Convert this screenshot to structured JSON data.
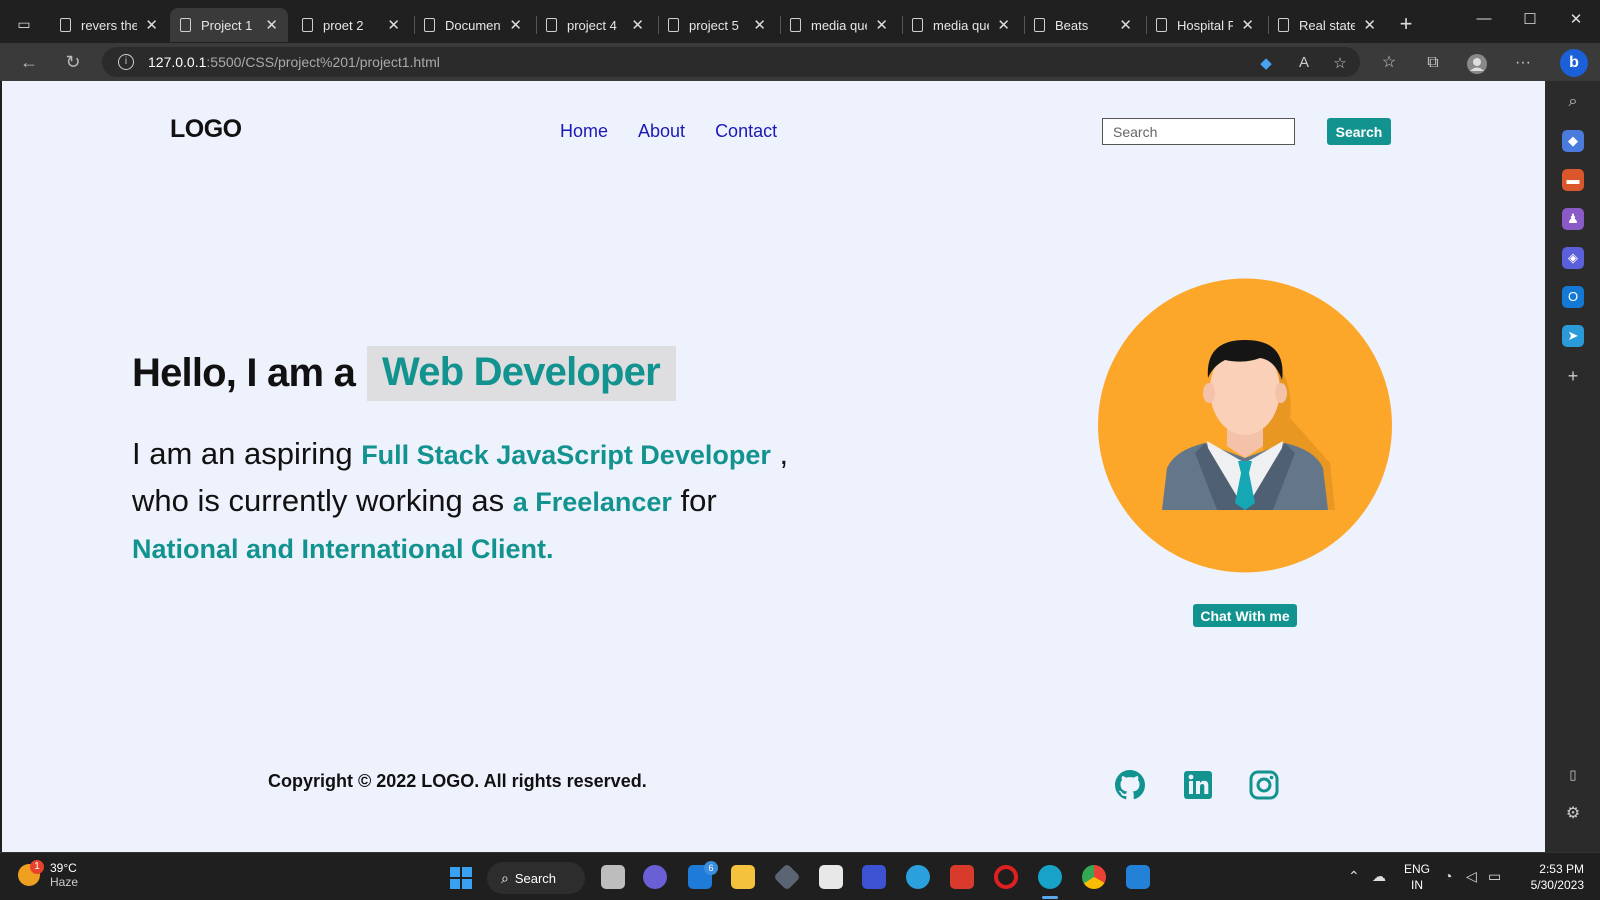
{
  "browser": {
    "tabs": [
      {
        "title": "revers the",
        "active": false
      },
      {
        "title": "Project 1",
        "active": true
      },
      {
        "title": "proet 2",
        "active": false
      },
      {
        "title": "Document",
        "active": false
      },
      {
        "title": "project 4",
        "active": false
      },
      {
        "title": "project 5",
        "active": false
      },
      {
        "title": "media que",
        "active": false
      },
      {
        "title": "media que",
        "active": false
      },
      {
        "title": "Beats",
        "active": false
      },
      {
        "title": "Hospital P",
        "active": false
      },
      {
        "title": "Real state",
        "active": false
      }
    ],
    "url_host": "127.0.0.1",
    "url_path": ":5500/CSS/project%201/project1.html"
  },
  "page": {
    "logo": "LOGO",
    "nav": [
      "Home",
      "About",
      "Contact"
    ],
    "search_placeholder": "Search",
    "search_button": "Search",
    "hero": {
      "greeting": "Hello, I am a",
      "role": "Web Developer",
      "desc_1": "I am an aspiring",
      "desc_hl_1": "Full Stack JavaScript Developer",
      "desc_2": ",",
      "desc_3": "who is currently working as",
      "desc_hl_2": "a Freelancer",
      "desc_4": "for",
      "desc_hl_3": "National and International Client."
    },
    "chat_button": "Chat With me",
    "copyright": "Copyright © 2022 LOGO. All rights reserved.",
    "social_icons": [
      "github-icon",
      "linkedin-icon",
      "instagram-icon"
    ]
  },
  "taskbar": {
    "temp": "39°C",
    "condition": "Haze",
    "weather_badge": "1",
    "search_label": "Search",
    "mail_badge": "6",
    "lang_1": "ENG",
    "lang_2": "IN",
    "time": "2:53 PM",
    "date": "5/30/2023"
  },
  "colors": {
    "accent": "#13938f",
    "page_bg": "#eef2fc",
    "avatar_bg": "#fca72a",
    "nav_link": "#1a1ab8"
  }
}
